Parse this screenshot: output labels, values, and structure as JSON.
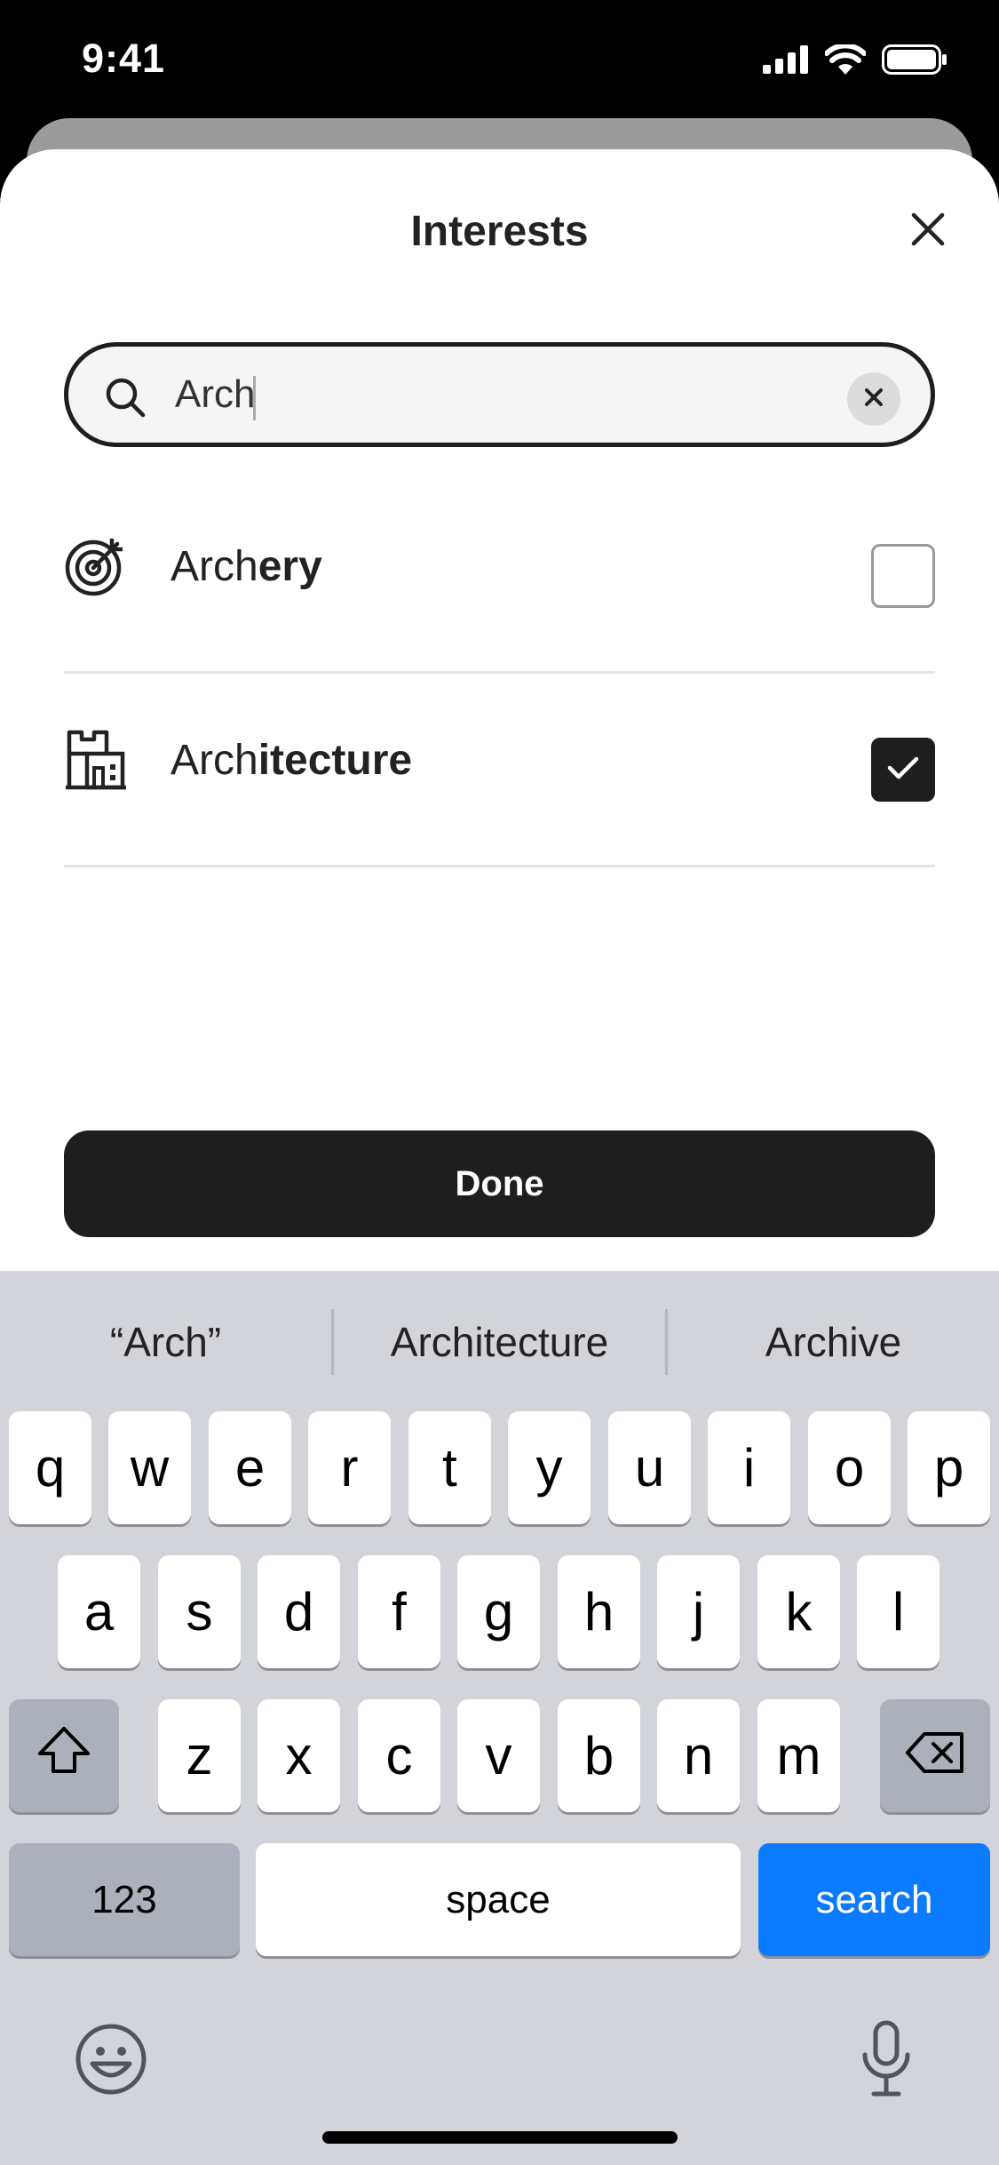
{
  "status_bar": {
    "time": "9:41"
  },
  "sheet": {
    "title": "Interests",
    "search": {
      "value": "Arch"
    },
    "items": [
      {
        "match": "Arch",
        "rest": "ery",
        "icon": "target-icon",
        "checked": false
      },
      {
        "match": "Arch",
        "rest": "itecture",
        "icon": "building-icon",
        "checked": true
      }
    ],
    "done_label": "Done"
  },
  "keyboard": {
    "suggestions": [
      "“Arch”",
      "Architecture",
      "Archive"
    ],
    "row1": [
      "q",
      "w",
      "e",
      "r",
      "t",
      "y",
      "u",
      "i",
      "o",
      "p"
    ],
    "row2": [
      "a",
      "s",
      "d",
      "f",
      "g",
      "h",
      "j",
      "k",
      "l"
    ],
    "row3": [
      "z",
      "x",
      "c",
      "v",
      "b",
      "n",
      "m"
    ],
    "numbers_label": "123",
    "space_label": "space",
    "search_label": "search",
    "accent_color": "#0a7aff"
  }
}
